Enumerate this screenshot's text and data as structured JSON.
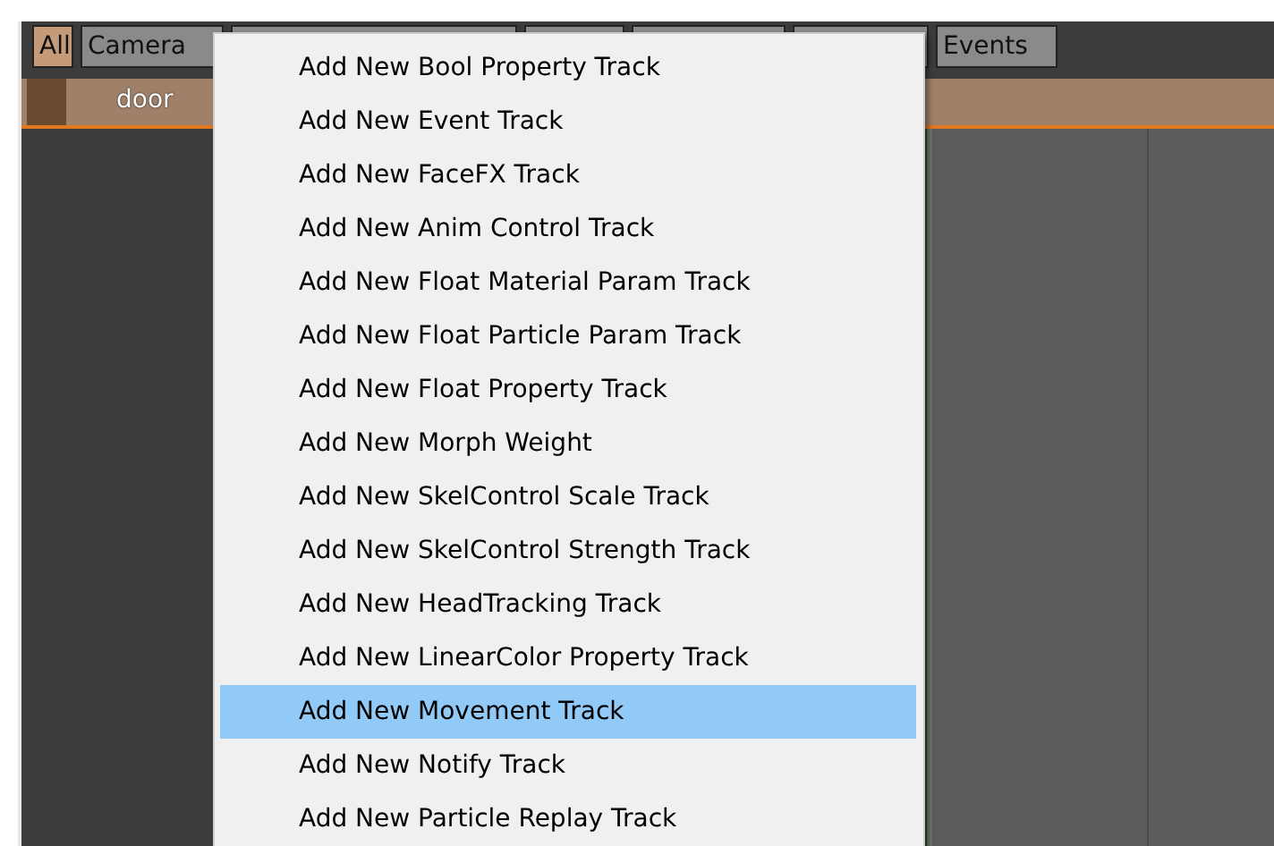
{
  "tabs": [
    {
      "label": "All",
      "selected": true
    },
    {
      "label": "Camera",
      "selected": false
    },
    {
      "selected": false
    },
    {
      "selected": false
    },
    {
      "selected": false
    },
    {
      "selected": false
    },
    {
      "label": "Events",
      "selected": false
    }
  ],
  "group_row": {
    "label": "door"
  },
  "context_menu": {
    "items": [
      {
        "label": "Add New Bool Property Track",
        "selected": false
      },
      {
        "label": "Add New Event Track",
        "selected": false
      },
      {
        "label": "Add New FaceFX Track",
        "selected": false
      },
      {
        "label": "Add New Anim Control Track",
        "selected": false
      },
      {
        "label": "Add New Float Material Param Track",
        "selected": false
      },
      {
        "label": "Add New Float Particle Param Track",
        "selected": false
      },
      {
        "label": "Add New Float Property Track",
        "selected": false
      },
      {
        "label": "Add New Morph Weight",
        "selected": false
      },
      {
        "label": "Add New SkelControl Scale Track",
        "selected": false
      },
      {
        "label": "Add New SkelControl Strength Track",
        "selected": false
      },
      {
        "label": "Add New HeadTracking Track",
        "selected": false
      },
      {
        "label": "Add New LinearColor Property Track",
        "selected": false
      },
      {
        "label": "Add New Movement Track",
        "selected": true
      },
      {
        "label": "Add New Notify Track",
        "selected": false
      },
      {
        "label": "Add New Particle Replay Track",
        "selected": false
      }
    ]
  }
}
